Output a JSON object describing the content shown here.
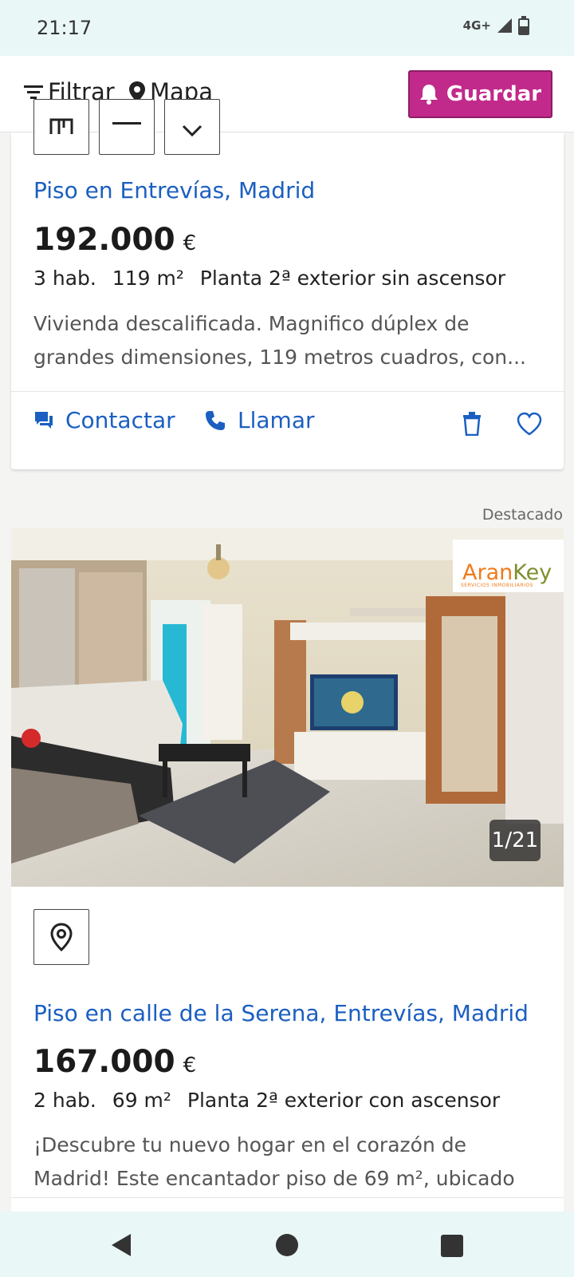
{
  "status_bar": {
    "time": "21:17",
    "network": "4G+"
  },
  "toolbar": {
    "filter_label": "Filtrar",
    "map_label": "Mapa",
    "save_label": "Guardar"
  },
  "listing1": {
    "title": "Piso en Entrevías, Madrid",
    "price": "192.000",
    "currency": "€",
    "rooms": "3 hab.",
    "area": "119 m²",
    "floor": "Planta 2ª exterior sin ascensor",
    "description": "Vivienda descalificada. Magnifico dúplex de grandes dimensiones, 119 metros cuadros, con...",
    "contact_label": "Contactar",
    "call_label": "Llamar"
  },
  "listing2": {
    "badge": "Destacado",
    "photo_counter": "1/21",
    "agency_logo_text": "AranKey",
    "agency_logo_sub": "SERVICIOS INMOBILIARIOS",
    "title": "Piso en calle de la Serena, Entrevías, Madrid",
    "price": "167.000",
    "currency": "€",
    "rooms": "2 hab.",
    "area": "69 m²",
    "floor": "Planta 2ª exterior con ascensor",
    "description": "¡Descubre tu nuevo hogar en el corazón de Madrid! Este encantador piso de 69 m², ubicado ..."
  },
  "colors": {
    "link_blue": "#1b5fc1",
    "save_magenta": "#c12a8a",
    "status_bg": "#e9f7f7"
  },
  "icons": [
    "filter-icon",
    "location-pin-icon",
    "bell-icon",
    "chat-icon",
    "phone-icon",
    "trash-icon",
    "heart-icon",
    "back-icon",
    "home-icon",
    "recents-icon"
  ]
}
